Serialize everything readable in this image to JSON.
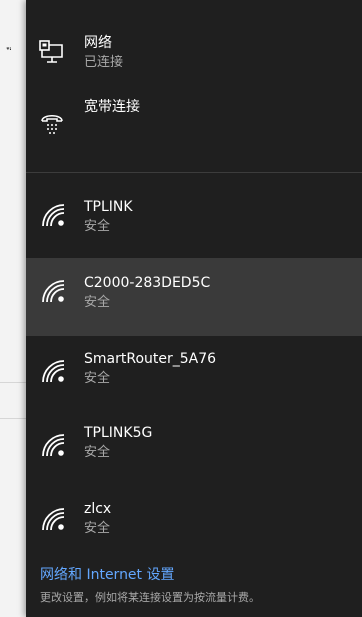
{
  "background": {
    "partial_char": "ֳ"
  },
  "top_items": [
    {
      "title": "网络",
      "status": "已连接",
      "icon": "ethernet-icon"
    },
    {
      "title": "宽带连接",
      "icon": "dialup-icon"
    }
  ],
  "wifi_networks": [
    {
      "ssid": "TPLINK",
      "security": "安全",
      "icon": "wifi-icon",
      "selected": false
    },
    {
      "ssid": "C2000-283DED5C",
      "security": "安全",
      "icon": "wifi-icon",
      "selected": true
    },
    {
      "ssid": "SmartRouter_5A76",
      "security": "安全",
      "icon": "wifi-icon",
      "selected": false
    },
    {
      "ssid": "TPLINK5G",
      "security": "安全",
      "icon": "wifi-icon",
      "selected": false
    },
    {
      "ssid": "zlcx",
      "security": "安全",
      "icon": "wifi-icon",
      "selected": false
    }
  ],
  "footer": {
    "link": "网络和 Internet 设置",
    "description": "更改设置，例如将某连接设置为按流量计费。"
  },
  "colors": {
    "flyout_bg": "#1f1f1f",
    "selected_bg": "#3a3a3a",
    "link": "#63a7ff",
    "secondary_text": "#a8a8a8"
  }
}
